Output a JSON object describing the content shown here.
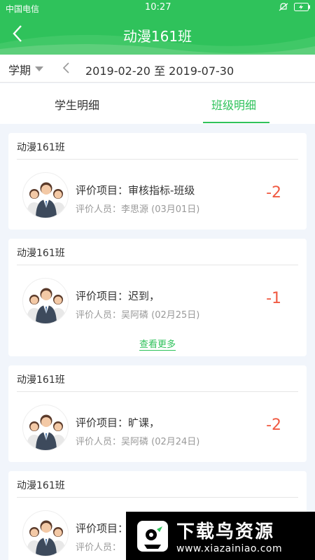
{
  "status_bar": {
    "carrier": "中国电信",
    "time": "10:27"
  },
  "header": {
    "title": "动漫161班"
  },
  "filter": {
    "term_label": "学期",
    "date_range": "2019-02-20 至 2019-07-30"
  },
  "tabs": [
    {
      "label": "学生明细",
      "active": false
    },
    {
      "label": "班级明细",
      "active": true
    }
  ],
  "cards": [
    {
      "class_name": "动漫161班",
      "item": "评价项目：审核指标-班级",
      "evaluator": "评价人员：李思源 (03月01日)",
      "score": "-2"
    },
    {
      "class_name": "动漫161班",
      "item": "评价项目：迟到，",
      "evaluator": "评价人员：吴阿磷 (02月25日)",
      "score": "-1",
      "see_more": "查看更多"
    },
    {
      "class_name": "动漫161班",
      "item": "评价项目：旷课，",
      "evaluator": "评价人员：吴阿磷 (02月24日)",
      "score": "-2"
    },
    {
      "class_name": "动漫161班",
      "item": "评价项目：",
      "evaluator": "评价人员：",
      "score": ""
    }
  ],
  "watermark": {
    "title": "下载鸟资源",
    "url": "www.xiazainiao.com"
  },
  "colors": {
    "primary": "#2fc25b",
    "score": "#f05a42"
  }
}
